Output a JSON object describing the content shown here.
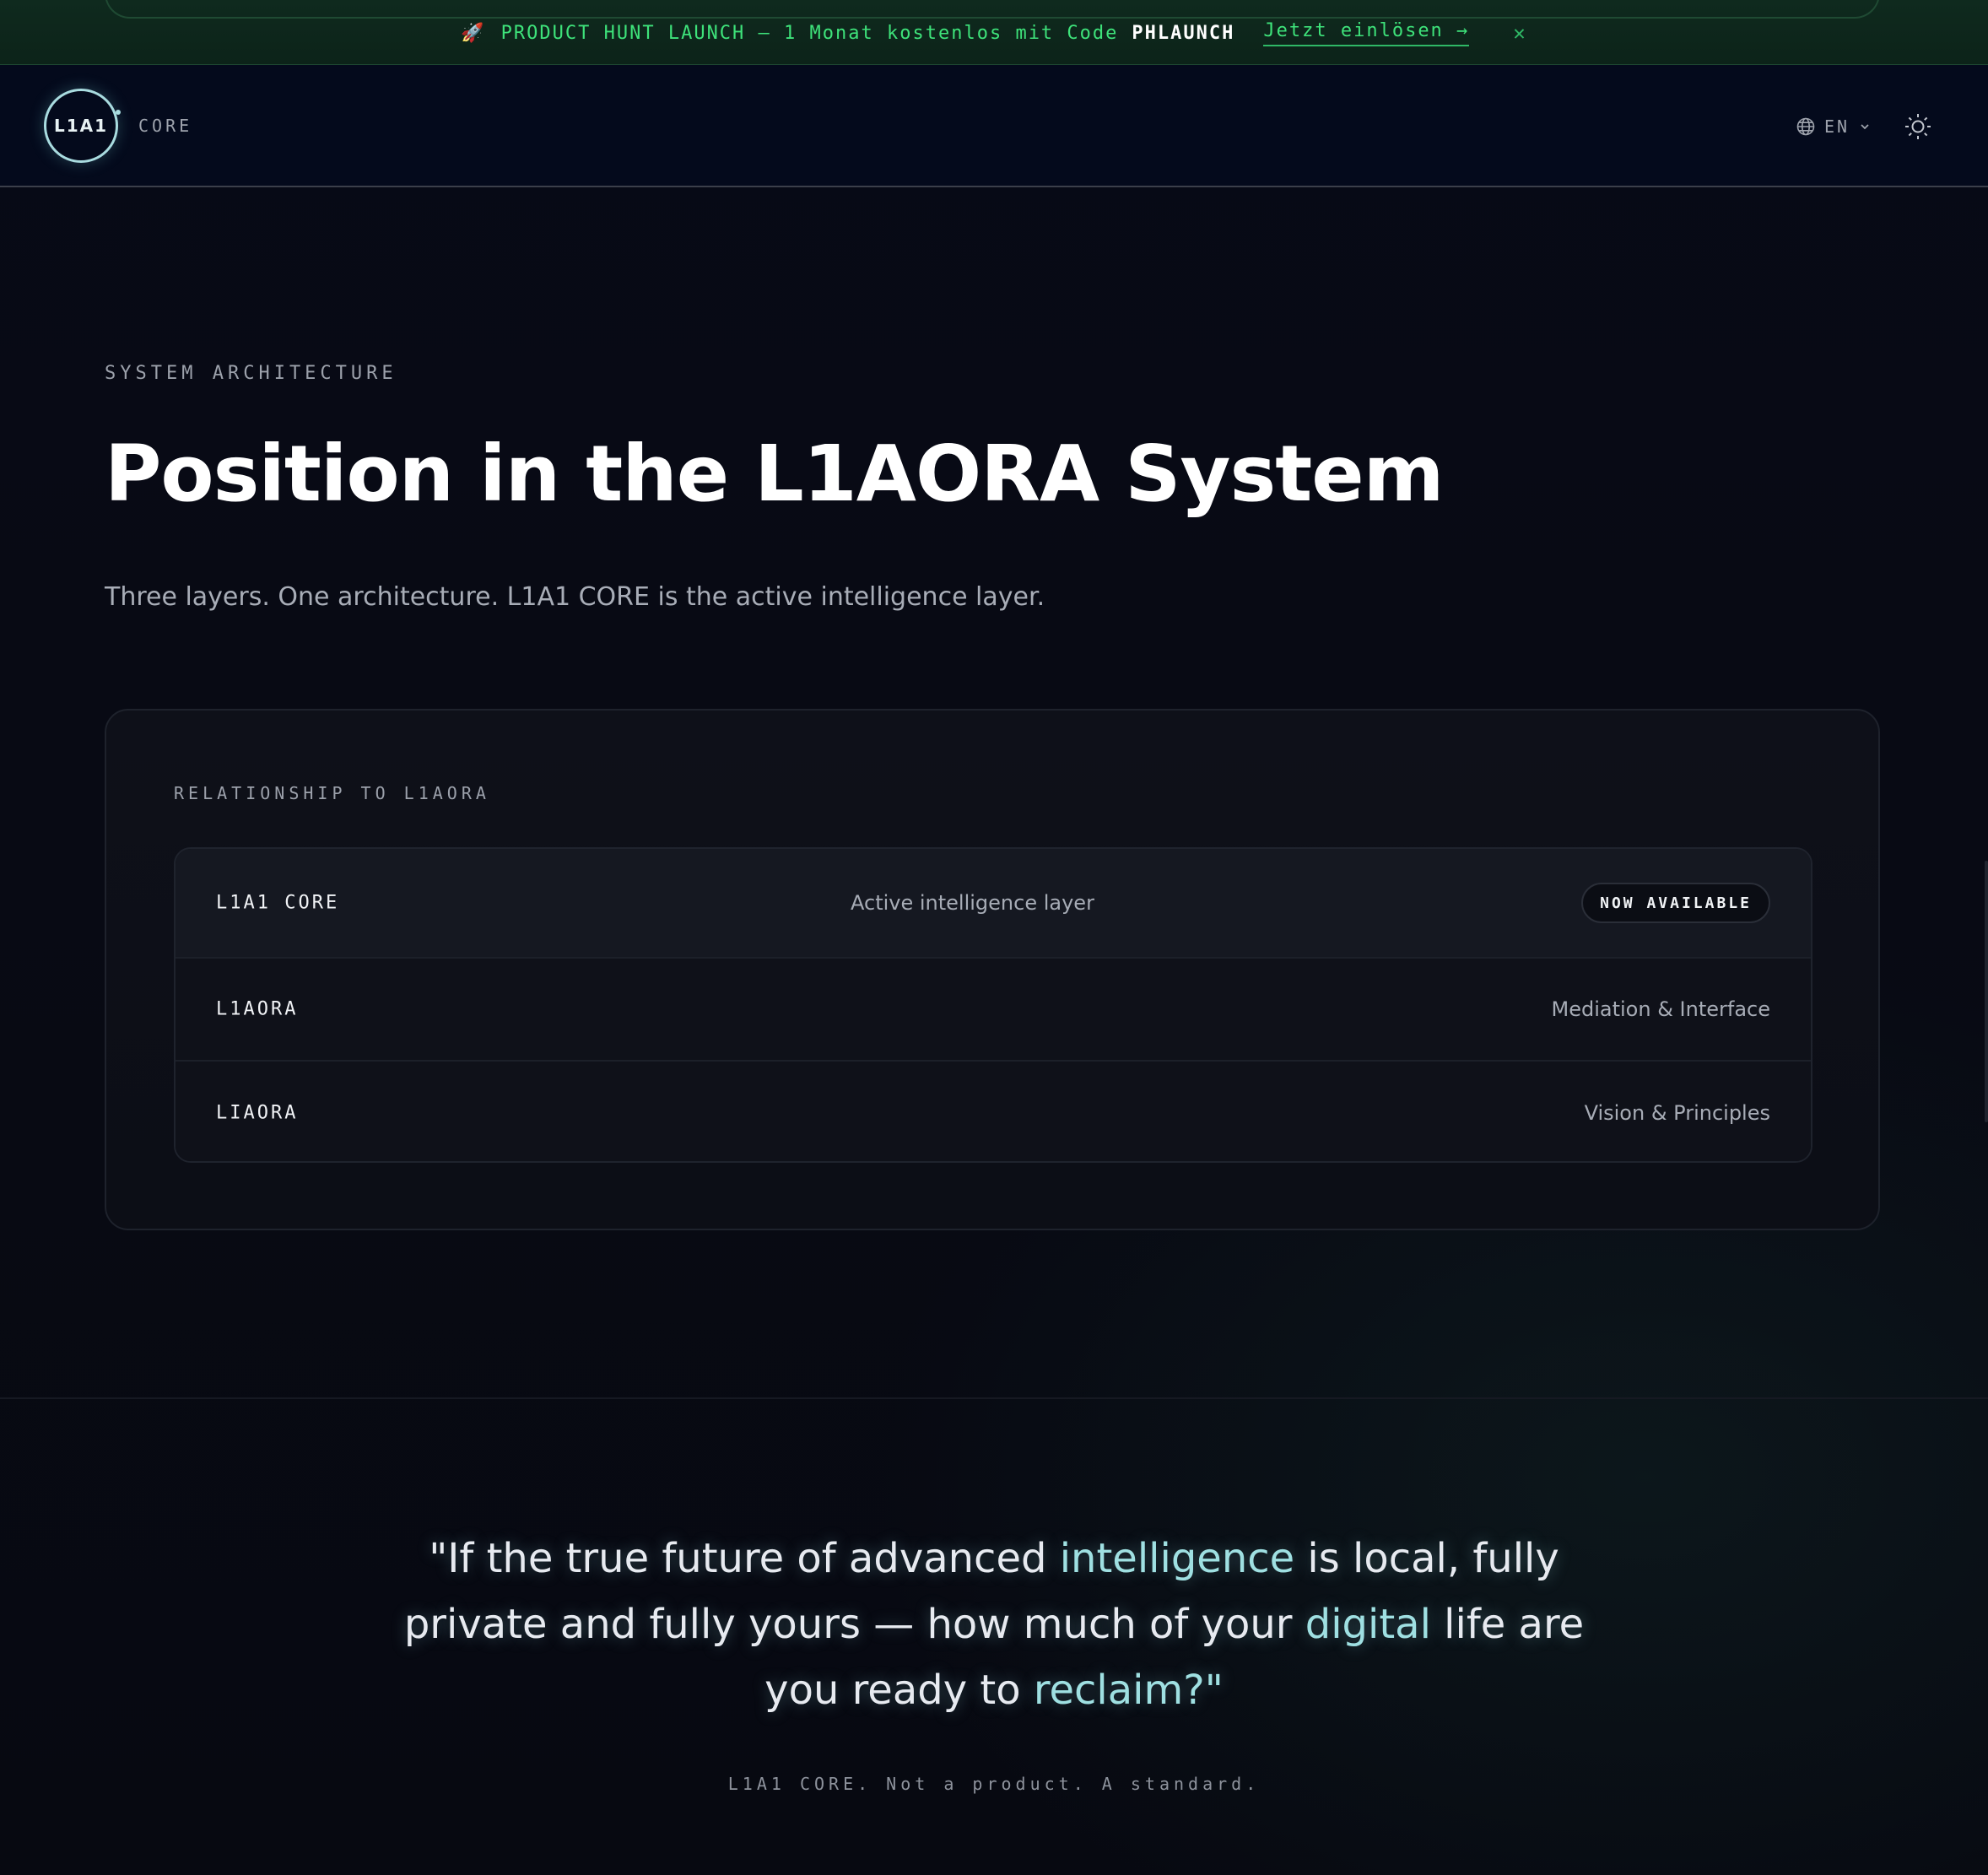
{
  "promo": {
    "rocket": "🚀",
    "text": "PRODUCT HUNT LAUNCH — 1 Monat kostenlos mit Code",
    "code": "PHLAUNCH",
    "link": "Jetzt einlösen →",
    "close": "✕"
  },
  "header": {
    "logo_text": "L1A1",
    "brand_sub": "CORE",
    "language": "EN",
    "icons": [
      "globe-icon",
      "chevron-down-icon",
      "sun-icon"
    ]
  },
  "section_architecture": {
    "eyebrow": "SYSTEM ARCHITECTURE",
    "title": "Position in the L1AORA System",
    "subtitle": "Three layers. One architecture. L1A1 CORE is the active intelligence layer.",
    "card_label": "RELATIONSHIP TO L1AORA",
    "rows": [
      {
        "name": "L1A1 CORE",
        "description": "Active intelligence layer",
        "badge": "NOW AVAILABLE"
      },
      {
        "name": "L1AORA",
        "description": "Mediation & Interface"
      },
      {
        "name": "LIAORA",
        "description": "Vision & Principles"
      }
    ]
  },
  "section_quote": {
    "quote_parts": {
      "p1": "\"If the true future of advanced ",
      "p2": "intelligence",
      "p3": " is local, fully private and fully yours — how much of your ",
      "p4": "digital",
      "p5": " life are you ready to ",
      "p6": "reclaim?\""
    },
    "tagline": "L1A1 CORE. Not a product. A standard."
  },
  "colors": {
    "promo_green": "#3ee27a",
    "background": "#070a14",
    "accent_cyan": "#9fe0e2"
  }
}
